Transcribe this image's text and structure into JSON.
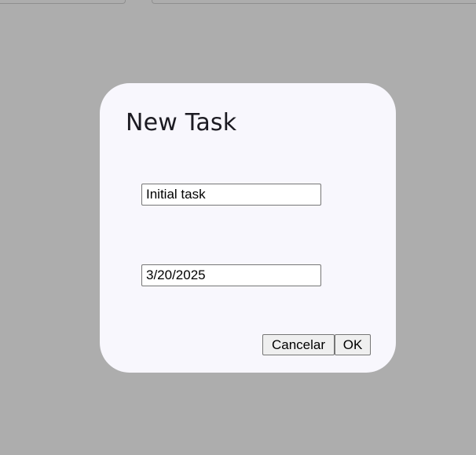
{
  "dialog": {
    "title": "New Task",
    "task_name_value": "Initial task",
    "date_value": "3/20/2025",
    "cancel_label": "Cancelar",
    "ok_label": "OK"
  },
  "colors": {
    "overlay": "#adadad",
    "dialog_background": "#f8f7fd",
    "title_text": "#1c1b22",
    "button_background": "#efefef"
  }
}
